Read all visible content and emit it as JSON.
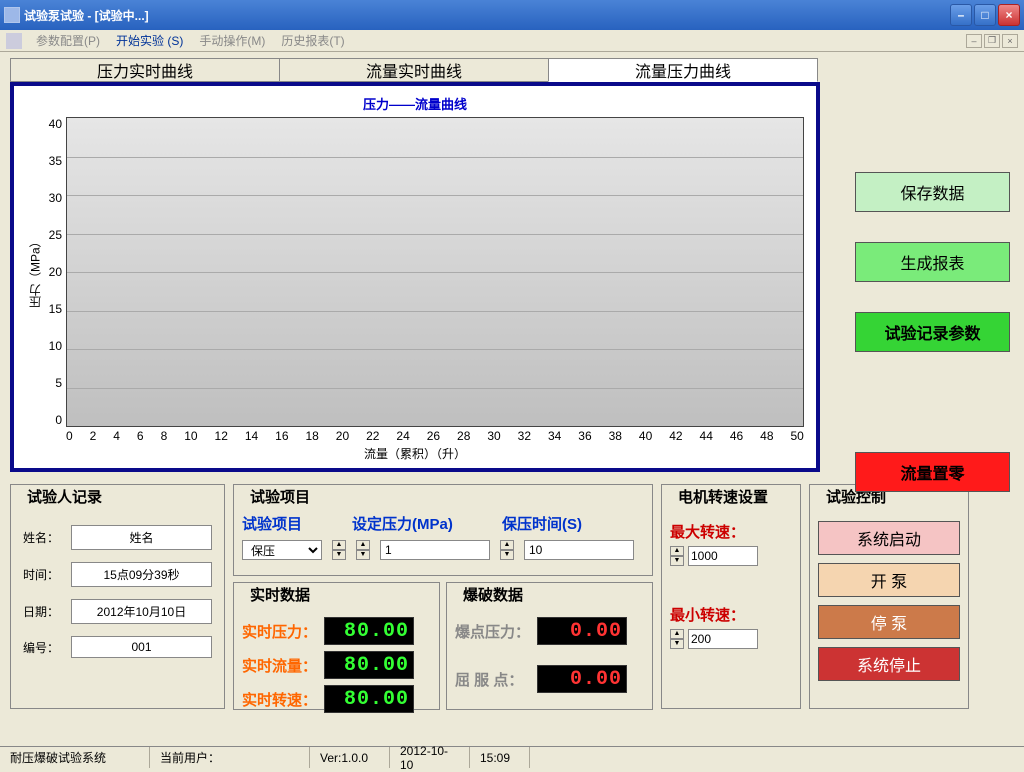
{
  "window": {
    "title": "试验泵试验  -  [试验中...]"
  },
  "menu": {
    "config": "参数配置(P)",
    "start": "开始实验 (S)",
    "manual": "手动操作(M)",
    "history": "历史报表(T)"
  },
  "tabs": {
    "pressure": "压力实时曲线",
    "flow": "流量实时曲线",
    "flow_pressure": "流量压力曲线"
  },
  "chart_data": {
    "type": "line",
    "title": "压力——流量曲线",
    "xlabel": "流量（累积）（升）",
    "ylabel": "压力（MPa）",
    "x_ticks": [
      0,
      2,
      4,
      6,
      8,
      10,
      12,
      14,
      16,
      18,
      20,
      22,
      24,
      26,
      28,
      30,
      32,
      34,
      36,
      38,
      40,
      42,
      44,
      46,
      48,
      50
    ],
    "y_ticks": [
      0,
      5,
      10,
      15,
      20,
      25,
      30,
      35,
      40
    ],
    "xlim": [
      0,
      50
    ],
    "ylim": [
      0,
      40
    ],
    "series": [
      {
        "name": "压力",
        "x": [],
        "y": []
      }
    ]
  },
  "right_buttons": {
    "save": "保存数据",
    "report": "生成报表",
    "record": "试验记录参数",
    "zero": "流量置零"
  },
  "tester": {
    "legend": "试验人记录",
    "name_label": "姓名：",
    "name_value": "姓名",
    "time_label": "时间：",
    "time_value": "15点09分39秒",
    "date_label": "日期：",
    "date_value": "2012年10月10日",
    "id_label": "编号：",
    "id_value": "001"
  },
  "project": {
    "legend": "试验项目",
    "col_project": "试验项目",
    "col_pressure": "设定压力(MPa)",
    "col_hold": "保压时间(S)",
    "project_value": "保压",
    "pressure_value": "1",
    "hold_value": "10"
  },
  "realtime": {
    "legend": "实时数据",
    "pressure_label": "实时压力：",
    "pressure_value": "80.00",
    "flow_label": "实时流量：",
    "flow_value": "80.00",
    "speed_label": "实时转速：",
    "speed_value": "80.00"
  },
  "burst": {
    "legend": "爆破数据",
    "point_label": "爆点压力：",
    "point_value": "0.00",
    "yield_label": "屈 服 点：",
    "yield_value": "0.00"
  },
  "motor": {
    "legend": "电机转速设置",
    "max_label": "最大转速：",
    "max_value": "1000",
    "min_label": "最小转速：",
    "min_value": "200"
  },
  "control": {
    "legend": "试验控制",
    "start": "系统启动",
    "open": "开    泵",
    "close": "停    泵",
    "stop": "系统停止"
  },
  "status": {
    "app": "耐压爆破试验系统",
    "user_label": "当前用户：",
    "ver": "Ver:1.0.0",
    "date": "2012-10-10",
    "time": "15:09"
  }
}
